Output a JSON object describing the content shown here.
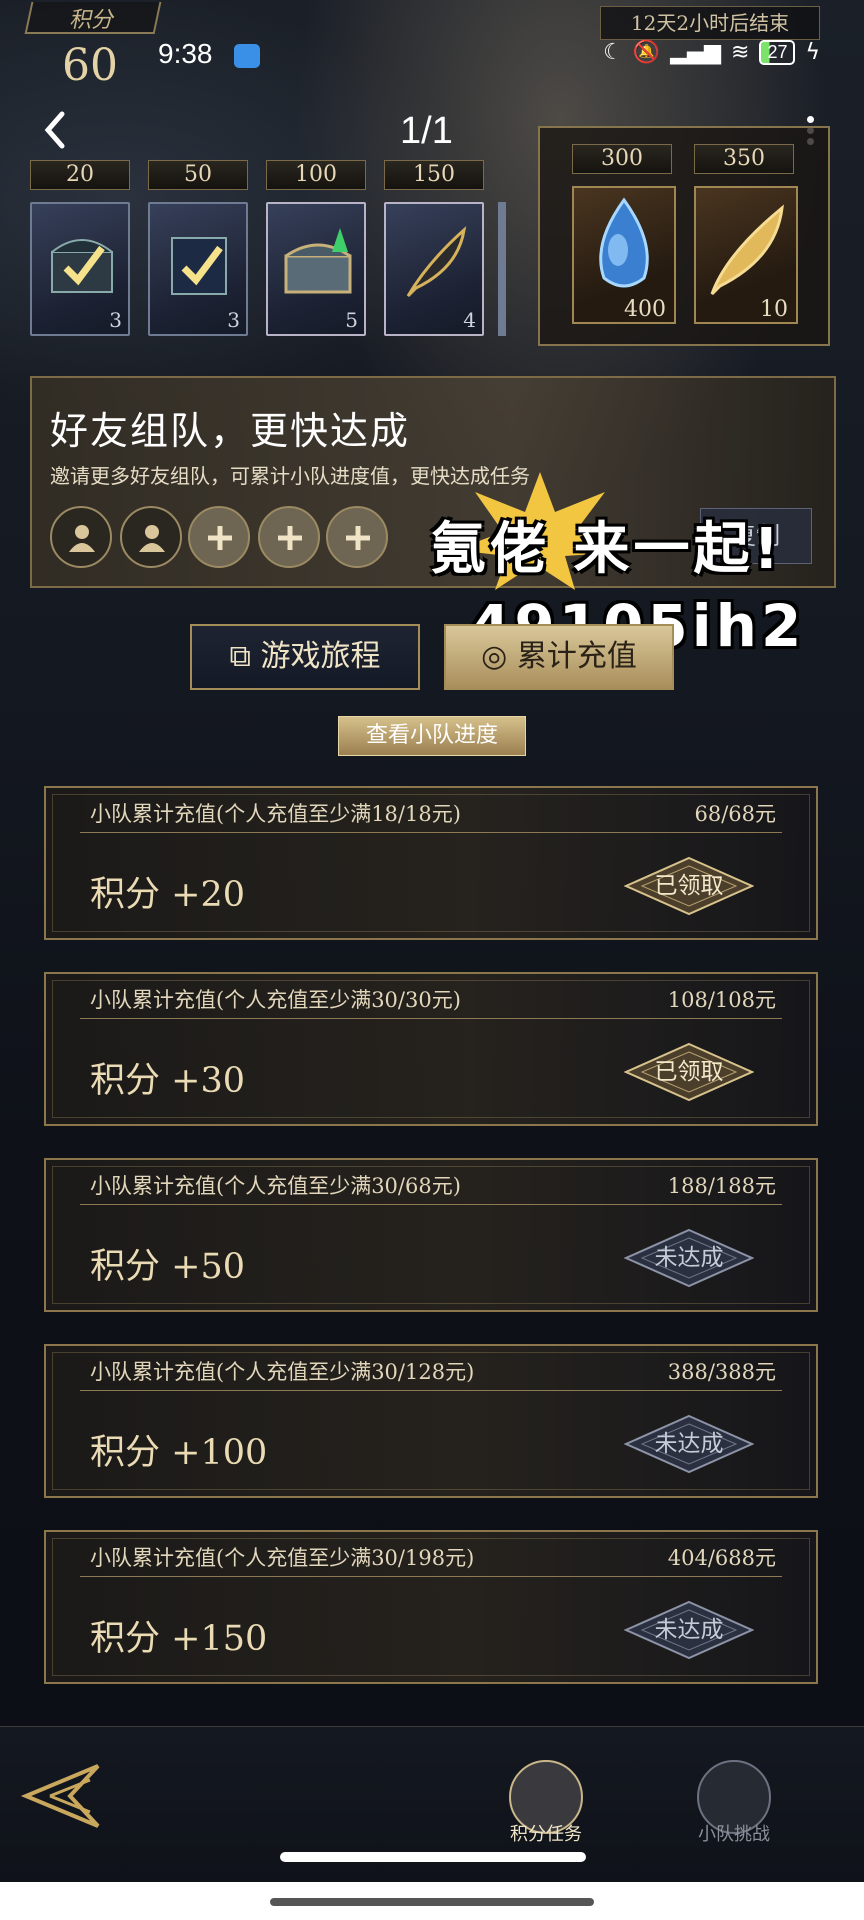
{
  "status_bar": {
    "time": "9:38",
    "battery": "27"
  },
  "points": {
    "label": "积分",
    "value": "60"
  },
  "event_timer": "12天2小时后结束",
  "page_indicator": "1/1",
  "milestones": [
    {
      "threshold": "20",
      "count": "3",
      "icon": "chest-checked-icon"
    },
    {
      "threshold": "50",
      "count": "3",
      "icon": "chest-checked-icon"
    },
    {
      "threshold": "100",
      "count": "5",
      "icon": "treasure-chest-icon"
    },
    {
      "threshold": "150",
      "count": "4",
      "icon": "feather-quill-icon"
    }
  ],
  "big_rewards": [
    {
      "threshold": "300",
      "count": "400",
      "icon": "blue-gem-icon"
    },
    {
      "threshold": "350",
      "count": "10",
      "icon": "golden-feather-icon"
    }
  ],
  "team": {
    "title": "好友组队，更快达成",
    "description": "邀请更多好友组队，可累计小队进度值，更快达成任务",
    "copy_label": "复制"
  },
  "overlay": {
    "line1": "氪佬 来一起!",
    "line2": "49105ih2"
  },
  "tabs": {
    "journey": "游戏旅程",
    "recharge": "累计充值"
  },
  "view_progress": "查看小队进度",
  "tasks": [
    {
      "desc": "小队累计充值(个人充值至少满18/18元)",
      "progress": "68/68元",
      "reward": "积分 +20",
      "status": "已领取",
      "state": "done"
    },
    {
      "desc": "小队累计充值(个人充值至少满30/30元)",
      "progress": "108/108元",
      "reward": "积分 +30",
      "status": "已领取",
      "state": "done"
    },
    {
      "desc": "小队累计充值(个人充值至少满30/68元)",
      "progress": "188/188元",
      "reward": "积分 +50",
      "status": "未达成",
      "state": "pending"
    },
    {
      "desc": "小队累计充值(个人充值至少满30/128元)",
      "progress": "388/388元",
      "reward": "积分 +100",
      "status": "未达成",
      "state": "pending"
    },
    {
      "desc": "小队累计充值(个人充值至少满30/198元)",
      "progress": "404/688元",
      "reward": "积分 +150",
      "status": "未达成",
      "state": "pending"
    }
  ],
  "bottom_nav": {
    "points_tasks": "积分任务",
    "team_challenge": "小队挑战"
  },
  "colors": {
    "gold": "#a58d58",
    "panel": "#141820",
    "accent_light": "#e4d3a6"
  }
}
